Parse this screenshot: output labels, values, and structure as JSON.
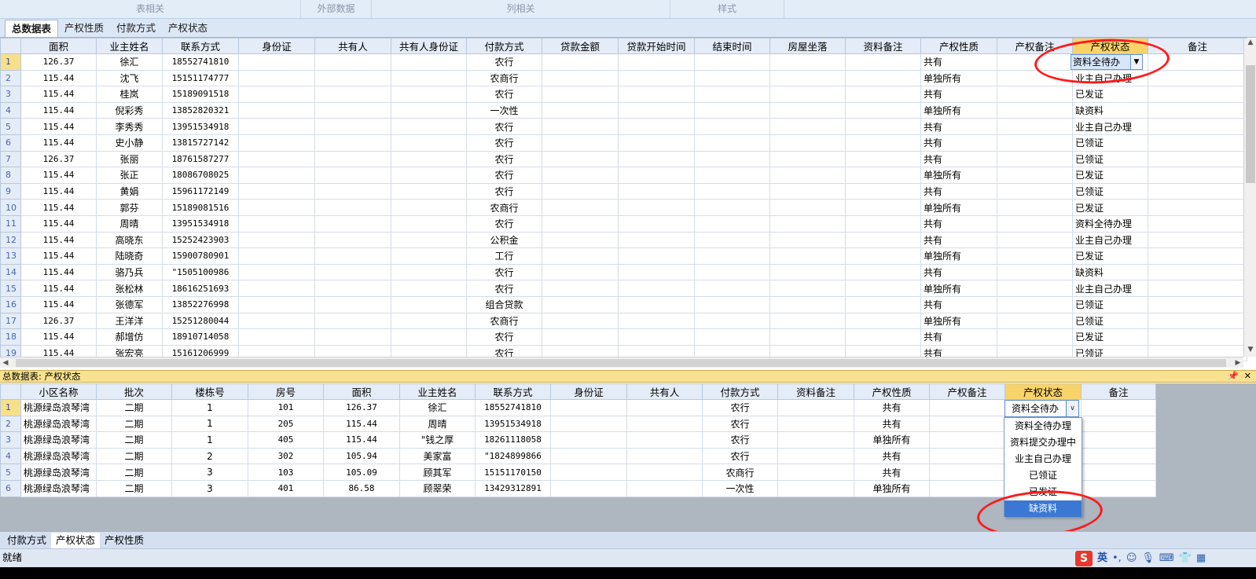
{
  "ribbon_groups": [
    "表相关",
    "外部数据",
    "列相关",
    "样式"
  ],
  "top_tabs": [
    {
      "label": "总数据表",
      "active": true
    },
    {
      "label": "产权性质",
      "active": false
    },
    {
      "label": "付款方式",
      "active": false
    },
    {
      "label": "产权状态",
      "active": false
    }
  ],
  "main_grid": {
    "columns": [
      "面积",
      "业主姓名",
      "联系方式",
      "身份证",
      "共有人",
      "共有人身份证",
      "付款方式",
      "贷款金额",
      "贷款开始时间",
      "结束时间",
      "房屋坐落",
      "资料备注",
      "产权性质",
      "产权备注",
      "产权状态",
      "备注"
    ],
    "rows": [
      [
        "1",
        "126.37",
        "徐汇",
        "18552741810",
        "",
        "",
        "",
        "农行",
        "",
        "",
        "",
        "",
        "",
        "共有",
        "",
        "资料全待办",
        ""
      ],
      [
        "2",
        "115.44",
        "沈飞",
        "15151174777",
        "",
        "",
        "",
        "农商行",
        "",
        "",
        "",
        "",
        "",
        "单独所有",
        "",
        "业主自己办理",
        ""
      ],
      [
        "3",
        "115.44",
        "桂岚",
        "15189091518",
        "",
        "",
        "",
        "农行",
        "",
        "",
        "",
        "",
        "",
        "共有",
        "",
        "已发证",
        ""
      ],
      [
        "4",
        "115.44",
        "倪彩秀",
        "13852820321",
        "",
        "",
        "",
        "一次性",
        "",
        "",
        "",
        "",
        "",
        "单独所有",
        "",
        "缺资料",
        ""
      ],
      [
        "5",
        "115.44",
        "李秀秀",
        "13951534918",
        "",
        "",
        "",
        "农行",
        "",
        "",
        "",
        "",
        "",
        "共有",
        "",
        "业主自己办理",
        ""
      ],
      [
        "6",
        "115.44",
        "史小静",
        "13815727142",
        "",
        "",
        "",
        "农行",
        "",
        "",
        "",
        "",
        "",
        "共有",
        "",
        "已领证",
        ""
      ],
      [
        "7",
        "126.37",
        "张丽",
        "18761587277",
        "",
        "",
        "",
        "农行",
        "",
        "",
        "",
        "",
        "",
        "共有",
        "",
        "已领证",
        ""
      ],
      [
        "8",
        "115.44",
        "张正",
        "18086708025",
        "",
        "",
        "",
        "农行",
        "",
        "",
        "",
        "",
        "",
        "单独所有",
        "",
        "已发证",
        ""
      ],
      [
        "9",
        "115.44",
        "黄娟",
        "15961172149",
        "",
        "",
        "",
        "农行",
        "",
        "",
        "",
        "",
        "",
        "共有",
        "",
        "已领证",
        ""
      ],
      [
        "10",
        "115.44",
        "郭芬",
        "15189081516",
        "",
        "",
        "",
        "农商行",
        "",
        "",
        "",
        "",
        "",
        "单独所有",
        "",
        "已发证",
        ""
      ],
      [
        "11",
        "115.44",
        "周晴",
        "13951534918",
        "",
        "",
        "",
        "农行",
        "",
        "",
        "",
        "",
        "",
        "共有",
        "",
        "资料全待办理",
        ""
      ],
      [
        "12",
        "115.44",
        "高晓东",
        "15252423903",
        "",
        "",
        "",
        "公积金",
        "",
        "",
        "",
        "",
        "",
        "共有",
        "",
        "业主自己办理",
        ""
      ],
      [
        "13",
        "115.44",
        "陆晓奇",
        "15900780901",
        "",
        "",
        "",
        "工行",
        "",
        "",
        "",
        "",
        "",
        "单独所有",
        "",
        "已发证",
        ""
      ],
      [
        "14",
        "115.44",
        "骆乃兵",
        "\"1505100986",
        "",
        "",
        "",
        "农行",
        "",
        "",
        "",
        "",
        "",
        "共有",
        "",
        "缺资料",
        ""
      ],
      [
        "15",
        "115.44",
        "张松林",
        "18616251693",
        "",
        "",
        "",
        "农行",
        "",
        "",
        "",
        "",
        "",
        "单独所有",
        "",
        "业主自己办理",
        ""
      ],
      [
        "16",
        "115.44",
        "张德军",
        "13852276998",
        "",
        "",
        "",
        "组合贷款",
        "",
        "",
        "",
        "",
        "",
        "共有",
        "",
        "已领证",
        ""
      ],
      [
        "17",
        "126.37",
        "王洋洋",
        "15251280044",
        "",
        "",
        "",
        "农商行",
        "",
        "",
        "",
        "",
        "",
        "单独所有",
        "",
        "已领证",
        ""
      ],
      [
        "18",
        "115.44",
        "郝增仿",
        "18910714058",
        "",
        "",
        "",
        "农行",
        "",
        "",
        "",
        "",
        "",
        "共有",
        "",
        "已发证",
        ""
      ],
      [
        "19",
        "115.44",
        "张宏亮",
        "15161206999",
        "",
        "",
        "",
        "农行",
        "",
        "",
        "",
        "",
        "",
        "共有",
        "",
        "已领证",
        ""
      ]
    ],
    "active_cell_value": "资料全待办"
  },
  "lower_panel": {
    "title": "总数据表: 产权状态",
    "pin_icon": "pin-icon",
    "close_icon": "close-icon",
    "columns": [
      "小区名称",
      "批次",
      "楼栋号",
      "房号",
      "面积",
      "业主姓名",
      "联系方式",
      "身份证",
      "共有人",
      "付款方式",
      "资料备注",
      "产权性质",
      "产权备注",
      "产权状态",
      "备注"
    ],
    "rows": [
      [
        "1",
        "桃源绿岛浪琴湾",
        "二期",
        "1",
        "101",
        "126.37",
        "徐汇",
        "18552741810",
        "",
        "",
        "农行",
        "",
        "共有",
        "",
        "资料全待办",
        ""
      ],
      [
        "2",
        "桃源绿岛浪琴湾",
        "二期",
        "1",
        "205",
        "115.44",
        "周晴",
        "13951534918",
        "",
        "",
        "农行",
        "",
        "共有",
        "",
        "",
        ""
      ],
      [
        "3",
        "桃源绿岛浪琴湾",
        "二期",
        "1",
        "405",
        "115.44",
        "\"钱之厚",
        "18261118058",
        "",
        "",
        "农行",
        "",
        "单独所有",
        "",
        "",
        ""
      ],
      [
        "4",
        "桃源绿岛浪琴湾",
        "二期",
        "2",
        "302",
        "105.94",
        "美家富",
        "\"1824899866",
        "",
        "",
        "农行",
        "",
        "共有",
        "",
        "",
        ""
      ],
      [
        "5",
        "桃源绿岛浪琴湾",
        "二期",
        "3",
        "103",
        "105.09",
        "顾其军",
        "15151170150",
        "",
        "",
        "农商行",
        "",
        "共有",
        "",
        "",
        ""
      ],
      [
        "6",
        "桃源绿岛浪琴湾",
        "二期",
        "3",
        "401",
        "86.58",
        "顾翠荣",
        "13429312891",
        "",
        "",
        "一次性",
        "",
        "单独所有",
        "",
        "",
        ""
      ]
    ],
    "combo_value": "资料全待办",
    "dropdown_options": [
      "资料全待办理",
      "资料提交办理中",
      "业主自己办理",
      "已领证",
      "已发证",
      "缺资料"
    ],
    "dropdown_highlight": "缺资料"
  },
  "bottom_tabs": [
    {
      "label": "付款方式",
      "active": false
    },
    {
      "label": "产权状态",
      "active": true
    },
    {
      "label": "产权性质",
      "active": false
    }
  ],
  "status": {
    "text": "就绪",
    "ime_logo": "S",
    "ime_lang": "英"
  },
  "colors": {
    "header_bg": "#e4ecf7",
    "selected_header": "#f8d36a",
    "panel_title_bg": "#f9e28f",
    "annotation_red": "#ff1a1a",
    "dropdown_highlight": "#3b78d3"
  }
}
